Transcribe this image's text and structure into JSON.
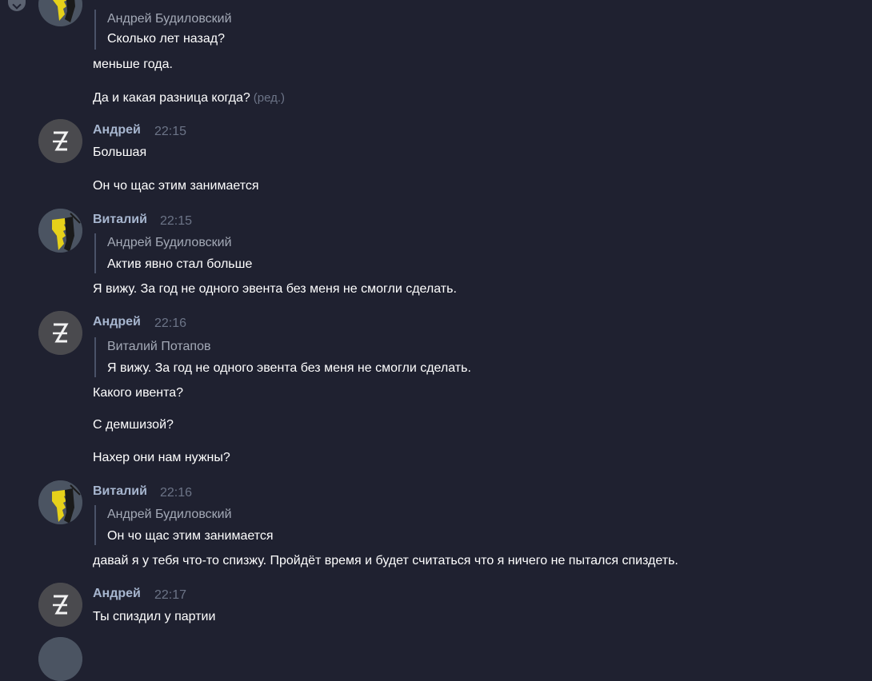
{
  "messages": [
    {
      "quote_author": "Андрей Будиловский",
      "quote_text": "Сколько лет назад?",
      "lines": [
        "меньше года.",
        "Да и какая разница когда?"
      ],
      "edited_label": "(ред.)"
    },
    {
      "author": "Андрей",
      "time": "22:15",
      "lines": [
        "Большая",
        "Он чо щас этим занимается"
      ]
    },
    {
      "author": "Виталий",
      "time": "22:15",
      "quote_author": "Андрей Будиловский",
      "quote_text": "Актив явно стал больше",
      "lines": [
        "Я вижу. За год не одного эвента без меня не смогли сделать."
      ]
    },
    {
      "author": "Андрей",
      "time": "22:16",
      "quote_author": "Виталий Потапов",
      "quote_text": "Я вижу. За год не одного эвента без меня не смогли сделать.",
      "lines": [
        "Какого ивента?",
        "С демшизой?",
        "Нахер они нам нужны?"
      ]
    },
    {
      "author": "Виталий",
      "time": "22:16",
      "quote_author": "Андрей Будиловский",
      "quote_text": "Он чо щас этим занимается",
      "lines": [
        "давай я у тебя что-то спизжу. Пройдёт время и будет считаться что я ничего не пытался спиздеть."
      ]
    },
    {
      "author": "Андрей",
      "time": "22:17",
      "lines": [
        "Ты спиздил у партии"
      ]
    }
  ],
  "icons": {
    "andrey_avatar": "avatar-icon-z-glyph",
    "vitaly_avatar": "avatar-icon-yellow-figure",
    "scroll": "chevron-down-icon"
  },
  "colors": {
    "background": "#1f2130",
    "author": "#a7b6cf",
    "timestamp": "#6c7487",
    "quote_bar": "#4a5268"
  }
}
